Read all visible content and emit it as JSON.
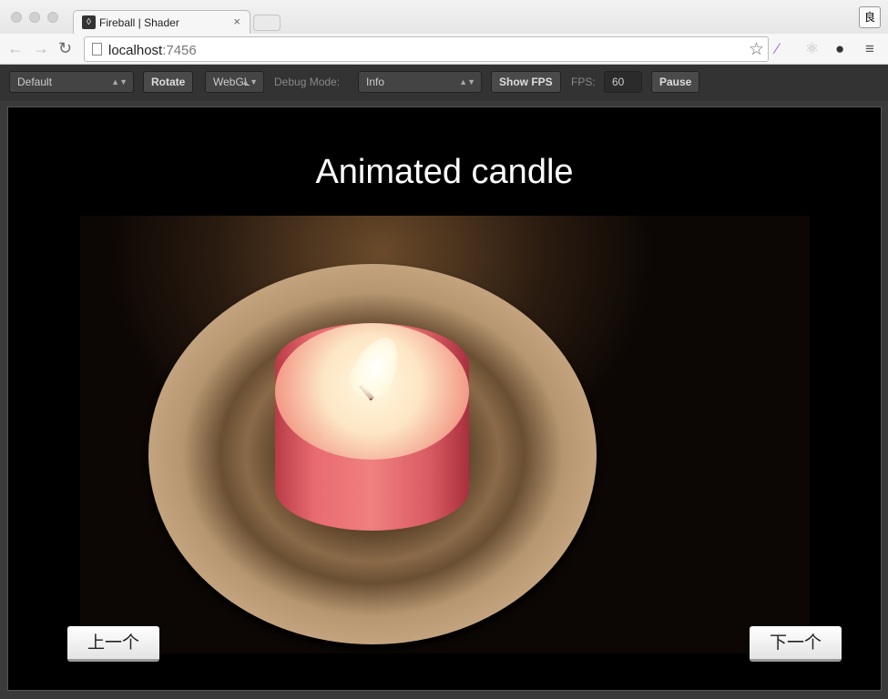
{
  "browser": {
    "tab_title": "Fireball | Shader",
    "url_host": "localhost",
    "url_port": ":7456",
    "ext_label": "良"
  },
  "toolbar": {
    "preset": "Default",
    "rotate": "Rotate",
    "renderer": "WebGL",
    "debug_label": "Debug Mode:",
    "debug_value": "Info",
    "show_fps": "Show FPS",
    "fps_label": "FPS:",
    "fps_value": "60",
    "pause": "Pause"
  },
  "stage": {
    "title": "Animated candle",
    "prev": "上一个",
    "next": "下一个"
  }
}
